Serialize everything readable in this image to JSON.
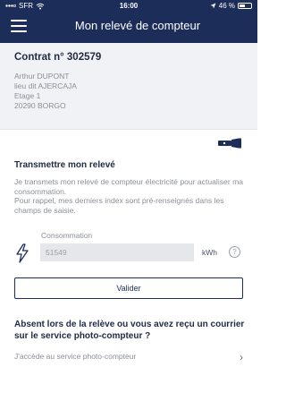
{
  "status_bar": {
    "carrier": "SFR",
    "time": "16:00",
    "battery": "46 %",
    "battery_level": 0.46
  },
  "header": {
    "title": "Mon relevé de compteur"
  },
  "contract": {
    "title": "Contrat n° 302579",
    "address_lines": [
      "Arthur DUPONT",
      "lieu dit AJERCAJA",
      "Etage 1",
      "20290 BORGO"
    ]
  },
  "reading": {
    "section_title": "Transmettre mon relevé",
    "description": "Je transmets mon relevé de compteur électricité pour actualiser ma consommation.\nPour rappel, mes derniers index sont pré-renseignés dans les champs de saisie.",
    "field_label": "Consommation",
    "field_value": "51549",
    "unit": "kWh",
    "help_icon": "?",
    "validate_label": "Valider"
  },
  "absent": {
    "title": "Absent lors de la relève ou vous avez reçu un courrier sur le service photo-compteur ?",
    "link_label": "J'accède au service photo-compteur",
    "chevron": "›"
  },
  "colors": {
    "header_bg": "#1c2d5a",
    "panel_bg": "#f1f2f5",
    "accent": "#1c2d5a"
  }
}
